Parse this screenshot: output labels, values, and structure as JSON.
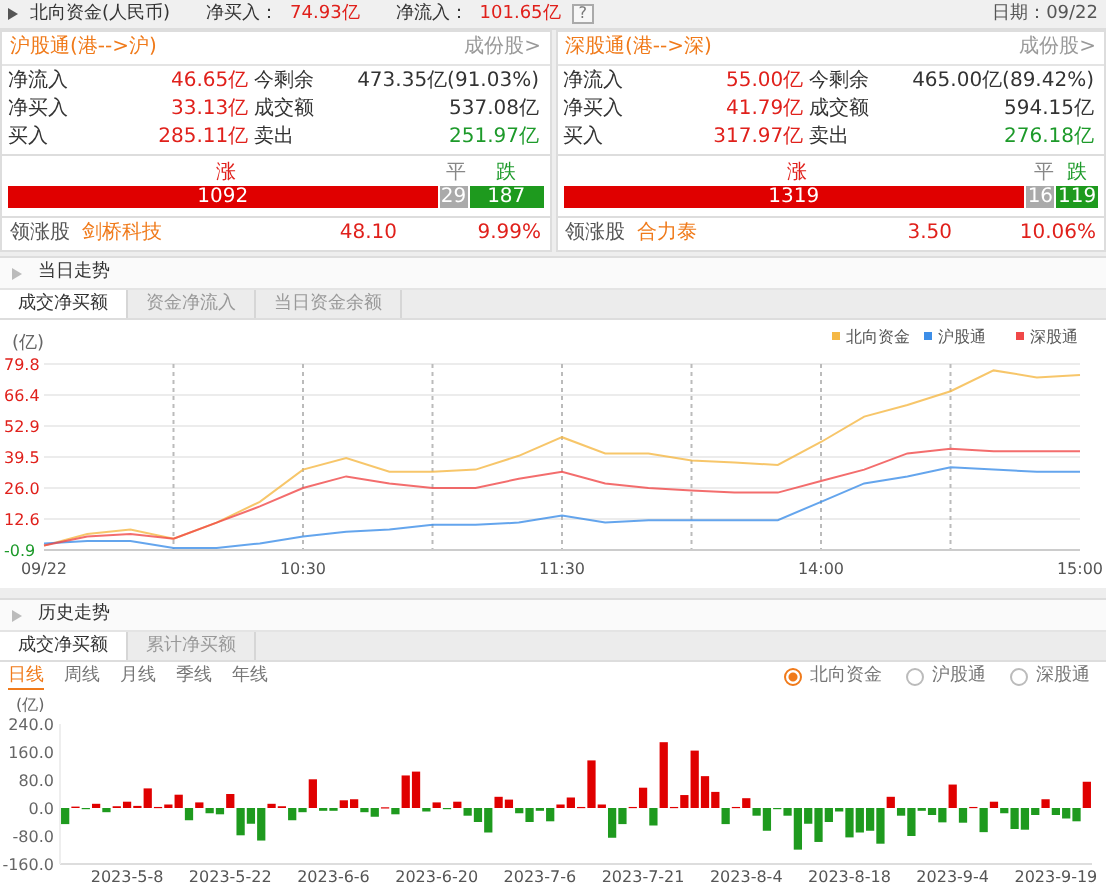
{
  "header": {
    "title": "北向资金(人民币)",
    "stats": [
      {
        "label": "净买入：",
        "value": "74.93亿"
      },
      {
        "label": "净流入：",
        "value": "101.65亿"
      }
    ],
    "help": "?",
    "date": "日期：09/22"
  },
  "panels": [
    {
      "title": "沪股通(港-->沪)",
      "link": "成份股>",
      "rows": [
        [
          {
            "label": "净流入",
            "value": "46.65亿",
            "color": "#e0201b"
          },
          {
            "label": "今剩余",
            "value": "473.35亿(91.03%)",
            "color": "#333333"
          }
        ],
        [
          {
            "label": "净买入",
            "value": "33.13亿",
            "color": "#e0201b"
          },
          {
            "label": "成交额",
            "value": "537.08亿",
            "color": "#333333"
          }
        ],
        [
          {
            "label": "买入",
            "value": "285.11亿",
            "color": "#e0201b"
          },
          {
            "label": "卖出",
            "value": "251.97亿",
            "color": "#1d9a2a"
          }
        ]
      ],
      "breadth": [
        {
          "label": "涨",
          "count": "1092",
          "kind": "up"
        },
        {
          "label": "平",
          "count": "29",
          "kind": "flat"
        },
        {
          "label": "跌",
          "count": "187",
          "kind": "down"
        }
      ],
      "leader": {
        "label": "领涨股",
        "name": "剑桥科技",
        "price": "48.10",
        "change": "9.99%"
      }
    },
    {
      "title": "深股通(港-->深)",
      "link": "成份股>",
      "rows": [
        [
          {
            "label": "净流入",
            "value": "55.00亿",
            "color": "#e0201b"
          },
          {
            "label": "今剩余",
            "value": "465.00亿(89.42%)",
            "color": "#333333"
          }
        ],
        [
          {
            "label": "净买入",
            "value": "41.79亿",
            "color": "#e0201b"
          },
          {
            "label": "成交额",
            "value": "594.15亿",
            "color": "#333333"
          }
        ],
        [
          {
            "label": "买入",
            "value": "317.97亿",
            "color": "#e0201b"
          },
          {
            "label": "卖出",
            "value": "276.18亿",
            "color": "#1d9a2a"
          }
        ]
      ],
      "breadth": [
        {
          "label": "涨",
          "count": "1319",
          "kind": "up"
        },
        {
          "label": "平",
          "count": "16",
          "kind": "flat"
        },
        {
          "label": "跌",
          "count": "119",
          "kind": "down"
        }
      ],
      "leader": {
        "label": "领涨股",
        "name": "合力泰",
        "price": "3.50",
        "change": "10.06%"
      }
    }
  ],
  "today": {
    "title": "当日走势",
    "tabs": [
      {
        "label": "成交净买额",
        "selected": true
      },
      {
        "label": "资金净流入",
        "selected": false
      },
      {
        "label": "当日资金余额",
        "selected": false
      }
    ],
    "chart_data": {
      "type": "line",
      "ylabel": "(亿)",
      "grid": true,
      "legend": true,
      "categories": [
        "09/22",
        null,
        null,
        null,
        null,
        null,
        "10:30",
        null,
        null,
        null,
        null,
        null,
        "11:30",
        null,
        null,
        null,
        null,
        null,
        "14:00",
        null,
        null,
        null,
        null,
        null,
        "15:00"
      ],
      "yticks": [
        {
          "value": -0.9,
          "label": "-0.9"
        },
        {
          "value": 12.6,
          "label": "12.6"
        },
        {
          "value": 26,
          "label": "26.0"
        },
        {
          "value": 39.5,
          "label": "39.5"
        },
        {
          "value": 52.9,
          "label": "52.9"
        },
        {
          "value": 66.4,
          "label": "66.4"
        },
        {
          "value": 79.8,
          "label": "79.8"
        }
      ],
      "ylim": [
        -0.9,
        79.8
      ],
      "series": [
        {
          "name": "北向资金",
          "color": "#f5b845",
          "values": [
            1,
            6,
            8,
            4,
            11,
            20,
            34,
            39,
            33,
            33,
            34,
            40,
            48,
            41,
            41,
            38,
            37,
            36,
            46,
            57,
            62,
            68,
            77,
            74,
            75
          ]
        },
        {
          "name": "沪股通",
          "color": "#3d8ee8",
          "values": [
            2,
            3,
            3,
            0,
            0,
            2,
            5,
            7,
            8,
            10,
            10,
            11,
            14,
            11,
            12,
            12,
            12,
            12,
            20,
            28,
            31,
            35,
            34,
            33,
            33
          ]
        },
        {
          "name": "深股通",
          "color": "#f04848",
          "values": [
            1,
            5,
            6,
            4,
            11,
            18,
            26,
            31,
            28,
            26,
            26,
            30,
            33,
            28,
            26,
            25,
            24,
            24,
            29,
            34,
            41,
            43,
            42,
            42,
            42
          ]
        }
      ]
    }
  },
  "history": {
    "title": "历史走势",
    "tabs": [
      {
        "label": "成交净买额",
        "selected": true
      },
      {
        "label": "累计净买额",
        "selected": false
      }
    ],
    "periods": [
      {
        "label": "日线",
        "selected": true
      },
      {
        "label": "周线",
        "selected": false
      },
      {
        "label": "月线",
        "selected": false
      },
      {
        "label": "季线",
        "selected": false
      },
      {
        "label": "年线",
        "selected": false
      }
    ],
    "scopes": [
      {
        "label": "北向资金",
        "selected": true
      },
      {
        "label": "沪股通",
        "selected": false
      },
      {
        "label": "深股通",
        "selected": false
      }
    ],
    "chart_data": {
      "type": "bar",
      "ylabel": "(亿)",
      "ylim": [
        -160,
        240
      ],
      "yticks": [
        {
          "value": -160,
          "label": "-160.0"
        },
        {
          "value": -80,
          "label": "-80.0"
        },
        {
          "value": 0,
          "label": "0.0"
        },
        {
          "value": 80,
          "label": "80.0"
        },
        {
          "value": 160,
          "label": "160.0"
        },
        {
          "value": 240,
          "label": "240.0"
        }
      ],
      "categories": [
        null,
        null,
        null,
        null,
        null,
        null,
        "2023-5-8",
        null,
        null,
        null,
        null,
        null,
        null,
        null,
        null,
        null,
        "2023-5-22",
        null,
        null,
        null,
        null,
        null,
        null,
        null,
        null,
        null,
        "2023-6-6",
        null,
        null,
        null,
        null,
        null,
        null,
        null,
        null,
        null,
        "2023-6-20",
        null,
        null,
        null,
        null,
        null,
        null,
        null,
        null,
        null,
        "2023-7-6",
        null,
        null,
        null,
        null,
        null,
        null,
        null,
        null,
        null,
        "2023-7-21",
        null,
        null,
        null,
        null,
        null,
        null,
        null,
        null,
        null,
        "2023-8-4",
        null,
        null,
        null,
        null,
        null,
        null,
        null,
        null,
        null,
        "2023-8-18",
        null,
        null,
        null,
        null,
        null,
        null,
        null,
        null,
        null,
        "2023-9-4",
        null,
        null,
        null,
        null,
        null,
        null,
        null,
        null,
        null,
        "2023-9-19",
        null,
        null,
        null
      ],
      "values": [
        -46,
        4,
        -3,
        12,
        -12,
        5,
        18,
        6,
        56,
        3,
        10,
        38,
        -35,
        16,
        -15,
        -18,
        40,
        -78,
        -45,
        -93,
        12,
        5,
        -35,
        -12,
        82,
        -8,
        -8,
        22,
        25,
        -12,
        -25,
        2,
        -18,
        93,
        104,
        -10,
        16,
        -2,
        18,
        -22,
        -40,
        -70,
        32,
        24,
        -15,
        -40,
        -8,
        -38,
        10,
        30,
        3,
        136,
        10,
        -85,
        -46,
        3,
        58,
        -50,
        188,
        3,
        37,
        164,
        91,
        46,
        -46,
        3,
        28,
        -22,
        -65,
        -2,
        -22,
        -119,
        -45,
        -97,
        -40,
        -10,
        -84,
        -70,
        -65,
        -102,
        32,
        -22,
        -80,
        -8,
        -20,
        -41,
        67,
        -42,
        3,
        -69,
        18,
        -15,
        -60,
        -62,
        -20,
        25,
        -20,
        -30,
        -38,
        75
      ]
    }
  }
}
